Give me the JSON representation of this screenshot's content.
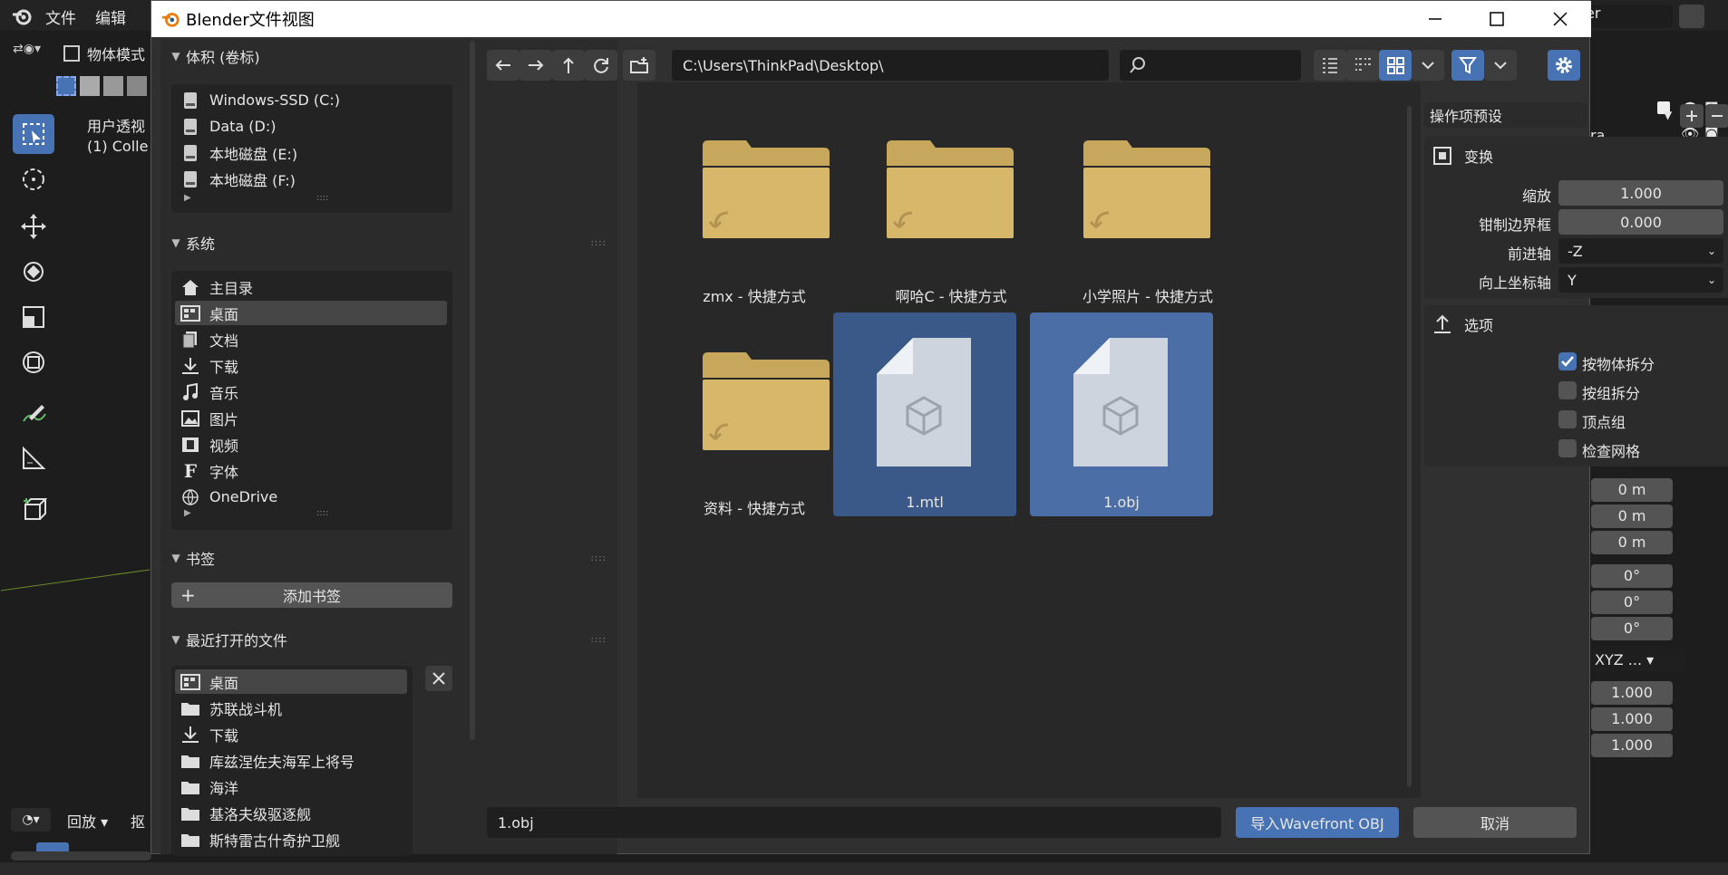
{
  "app": {
    "menu": [
      "文件",
      "编辑"
    ],
    "mode": "物体模式",
    "viewport_title": "用户透视",
    "viewport_sub": "(1) Colle",
    "playback": "回放",
    "capture": "抠",
    "right_search": "er",
    "right_partial": "ra"
  },
  "right_panel": {
    "values_m": [
      "0 m",
      "0 m",
      "0 m"
    ],
    "values_deg": [
      "0°",
      "0°",
      "0°"
    ],
    "rotation_mode": "XYZ ...",
    "scale": [
      "1.000",
      "1.000",
      "1.000"
    ]
  },
  "dialog": {
    "title": "Blender文件视图",
    "sidebar": {
      "volumes": {
        "title": "体积 (卷标)",
        "items": [
          "Windows-SSD (C:)",
          "Data (D:)",
          "本地磁盘 (E:)",
          "本地磁盘 (F:)"
        ]
      },
      "system": {
        "title": "系统",
        "items": [
          {
            "label": "主目录",
            "icon": "home-icon"
          },
          {
            "label": "桌面",
            "icon": "desktop-icon",
            "selected": true
          },
          {
            "label": "文档",
            "icon": "documents-icon"
          },
          {
            "label": "下载",
            "icon": "download-icon"
          },
          {
            "label": "音乐",
            "icon": "music-icon"
          },
          {
            "label": "图片",
            "icon": "image-icon"
          },
          {
            "label": "视频",
            "icon": "video-icon"
          },
          {
            "label": "字体",
            "icon": "font-icon"
          },
          {
            "label": "OneDrive",
            "icon": "globe-icon"
          }
        ]
      },
      "bookmarks": {
        "title": "书签",
        "add_label": "添加书签"
      },
      "recent": {
        "title": "最近打开的文件",
        "items": [
          "桌面",
          "苏联战斗机",
          "下载",
          "库兹涅佐夫海军上将号",
          "海洋",
          "基洛夫级驱逐舰",
          "斯特雷古什奇护卫舰"
        ]
      }
    },
    "path": "C:\\Users\\ThinkPad\\Desktop\\",
    "search_placeholder": "",
    "files": [
      {
        "name": "zmx - 快捷方式",
        "type": "folder"
      },
      {
        "name": "啊哈C - 快捷方式",
        "type": "folder"
      },
      {
        "name": "小学照片 - 快捷方式",
        "type": "folder"
      },
      {
        "name": "资料 - 快捷方式",
        "type": "folder"
      },
      {
        "name": "1.mtl",
        "type": "file",
        "selected": true
      },
      {
        "name": "1.obj",
        "type": "file",
        "selected": true
      }
    ],
    "options": {
      "preset": "操作项预设",
      "transform": {
        "title": "变换",
        "scale_label": "缩放",
        "scale": "1.000",
        "clamp_label": "钳制边界框",
        "clamp": "0.000",
        "forward_label": "前进轴",
        "forward": "-Z",
        "up_label": "向上坐标轴",
        "up": "Y"
      },
      "options": {
        "title": "选项",
        "items": [
          {
            "label": "按物体拆分",
            "checked": true
          },
          {
            "label": "按组拆分",
            "checked": false
          },
          {
            "label": "顶点组",
            "checked": false
          },
          {
            "label": "检查网格",
            "checked": false
          }
        ]
      }
    },
    "filename": "1.obj",
    "import_label": "导入Wavefront OBJ",
    "cancel_label": "取消"
  },
  "colors": {
    "accent": "#4772b3",
    "folder": "#d7b76a",
    "selected_tile": "#3b5988"
  }
}
